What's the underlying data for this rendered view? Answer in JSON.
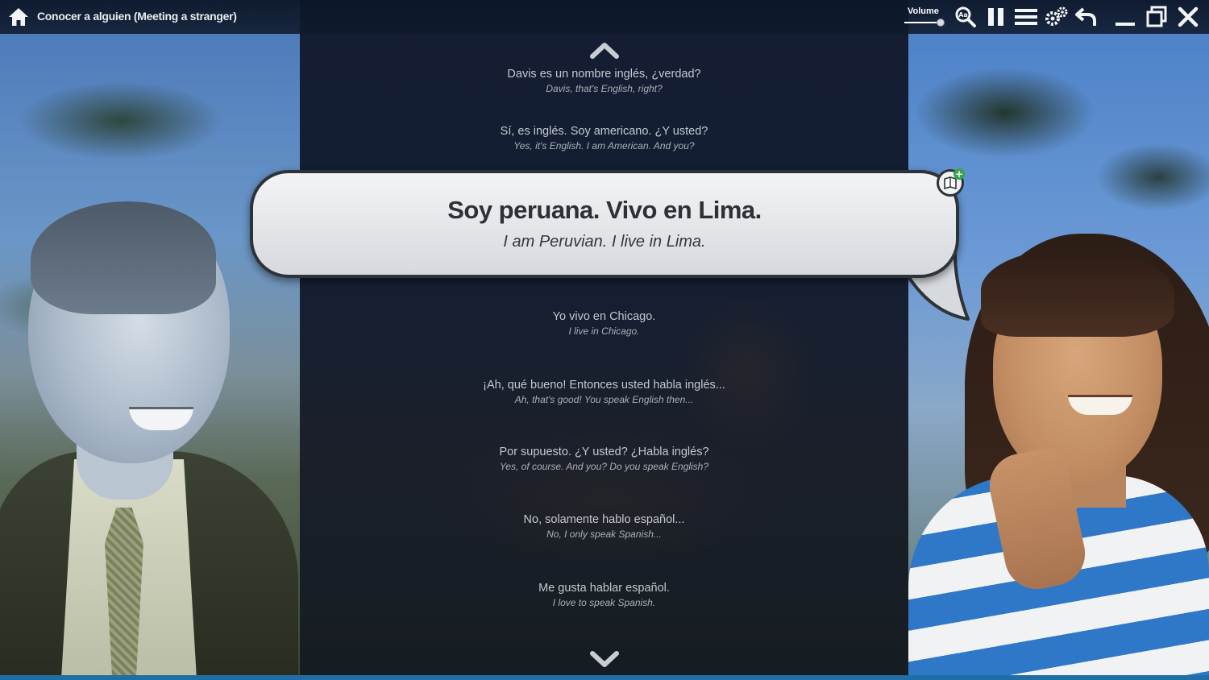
{
  "app": {
    "lesson_title": "Conocer a alguien (Meeting a stranger)",
    "volume_label": "Volume"
  },
  "toolbar": {
    "icons": [
      "home-icon",
      "zoom-font-icon",
      "pause-icon",
      "menu-icon",
      "settings-icon",
      "back-icon",
      "minimize-icon",
      "restore-icon",
      "close-icon"
    ]
  },
  "dialogue": {
    "lines": [
      {
        "es": "Davis es un nombre inglés, ¿verdad?",
        "en": "Davis, that's English, right?"
      },
      {
        "es": "Sí, es inglés. Soy americano. ¿Y usted?",
        "en": "Yes, it's English. I am American. And you?"
      },
      {
        "es": "Yo vivo en Chicago.",
        "en": "I live in Chicago."
      },
      {
        "es": "¡Ah, qué bueno! Entonces usted habla inglés...",
        "en": "Ah, that's good! You speak English then..."
      },
      {
        "es": "Por supuesto. ¿Y usted? ¿Habla inglés?",
        "en": "Yes, of course. And you? Do you speak English?"
      },
      {
        "es": "No, solamente hablo español...",
        "en": "No, I only speak Spanish..."
      },
      {
        "es": "Me gusta hablar español.",
        "en": "I love to speak Spanish."
      }
    ],
    "current": {
      "es": "Soy peruana. Vivo en Lima.",
      "en": "I am Peruvian. I live in Lima."
    }
  },
  "colors": {
    "topbar": "#0c1628",
    "bubble": "#e8eaed",
    "accent_blue": "#1f6fa6",
    "add_green": "#3aa24a"
  }
}
